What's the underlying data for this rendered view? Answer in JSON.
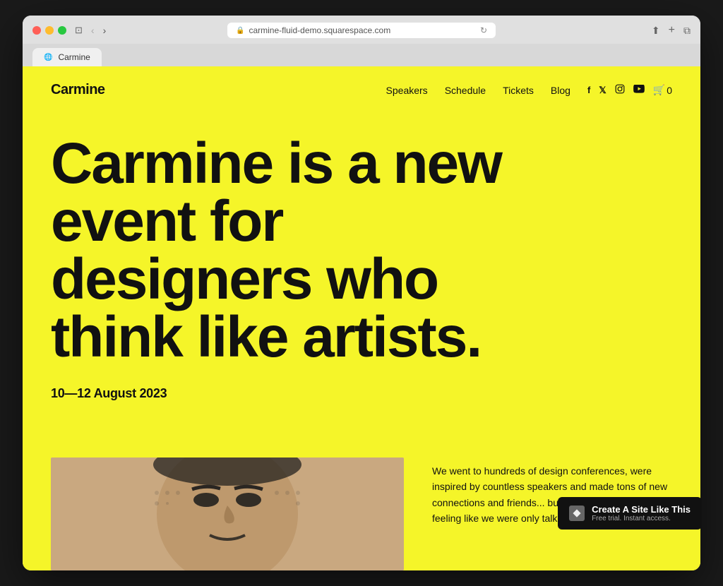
{
  "browser": {
    "url": "carmine-fluid-demo.squarespace.com",
    "tab_label": "Carmine"
  },
  "nav": {
    "logo": "Carmine",
    "links": [
      "Speakers",
      "Schedule",
      "Tickets",
      "Blog"
    ],
    "cart_count": "0"
  },
  "hero": {
    "headline": "Carmine is a new event for designers who think like artists.",
    "date": "10—12 August 2023"
  },
  "body_text": "We went to hundreds of design conferences, were inspired by countless speakers and made tons of new connections and friends... but always walked away feeling like we were only talki...",
  "badge": {
    "title": "Create A Site Like This",
    "subtitle": "Free trial. Instant access."
  },
  "colors": {
    "background": "#f5f529",
    "text": "#111111",
    "badge_bg": "#111111"
  }
}
